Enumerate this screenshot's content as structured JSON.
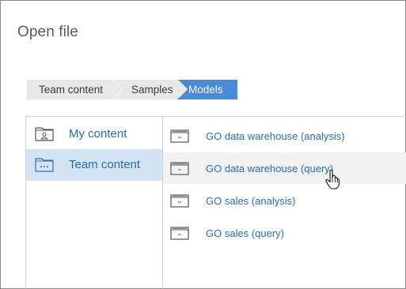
{
  "dialog": {
    "title": "Open file"
  },
  "breadcrumb": [
    {
      "label": "Team content"
    },
    {
      "label": "Samples"
    },
    {
      "label": "Models",
      "active": true
    }
  ],
  "sidebar": {
    "items": [
      {
        "label": "My content",
        "icon": "user-folder-icon"
      },
      {
        "label": "Team content",
        "icon": "team-folder-icon",
        "selected": true
      }
    ]
  },
  "files": [
    {
      "label": "GO data warehouse (analysis)",
      "icon": "data-module-icon"
    },
    {
      "label": "GO data warehouse (query)",
      "icon": "data-module-icon",
      "hovered": true
    },
    {
      "label": "GO sales (analysis)",
      "icon": "data-module-icon"
    },
    {
      "label": "GO sales (query)",
      "icon": "data-module-icon"
    }
  ],
  "colors": {
    "accent": "#4a8ad6",
    "link": "#2a6bb3",
    "selected_bg": "#d3e4f5",
    "hover_bg": "#f2f2f2"
  }
}
